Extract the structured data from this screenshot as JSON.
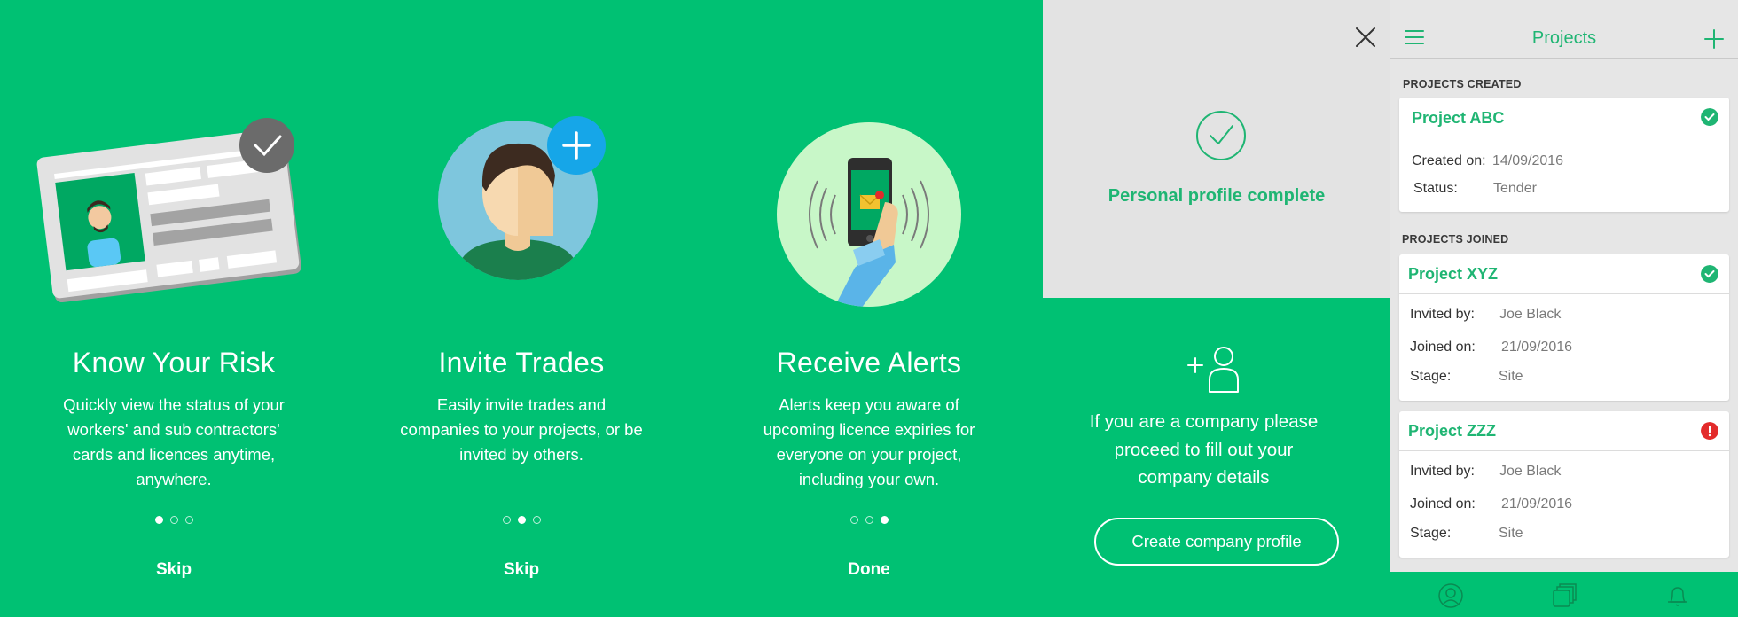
{
  "onboarding": [
    {
      "title": "Know Your Risk",
      "description": "Quickly view the status of your workers' and sub contractors' cards and licences anytime, anywhere.",
      "action": "Skip"
    },
    {
      "title": "Invite Trades",
      "description": "Easily invite trades and companies to your projects, or be invited by others.",
      "action": "Skip"
    },
    {
      "title": "Receive Alerts",
      "description": "Alerts keep you aware of upcoming licence expiries for everyone on your project, including your own.",
      "action": "Done"
    }
  ],
  "complete": {
    "message": "Personal profile complete",
    "company_text": "If you are a company please proceed to fill out your company details",
    "button": "Create company profile"
  },
  "projects": {
    "title": "Projects",
    "created_label": "PROJECTS CREATED",
    "joined_label": "PROJECTS JOINED",
    "created": [
      {
        "name": "Project ABC",
        "status_icon": "check-icon",
        "created_on_label": "Created on:",
        "created_on": "14/09/2016",
        "status_label": "Status:",
        "status": "Tender"
      }
    ],
    "joined": [
      {
        "name": "Project XYZ",
        "status_icon": "check-icon",
        "invited_label": "Invited by:",
        "invited_by": "Joe Black",
        "joined_label": "Joined on:",
        "joined_on": "21/09/2016",
        "stage_label": "Stage:",
        "stage": "Site"
      },
      {
        "name": "Project ZZZ",
        "status_icon": "alert-icon",
        "invited_label": "Invited by:",
        "invited_by": "Joe Black",
        "joined_label": "Joined on:",
        "joined_on": "21/09/2016",
        "stage_label": "Stage:",
        "stage": "Site"
      }
    ],
    "bottom_tabs": [
      "profile-icon",
      "cards-icon",
      "bell-icon"
    ]
  },
  "colors": {
    "brand_green": "#00c173",
    "text_green": "#1fb573",
    "alert_red": "#e32b2b",
    "invite_blue": "#16a6e8"
  }
}
